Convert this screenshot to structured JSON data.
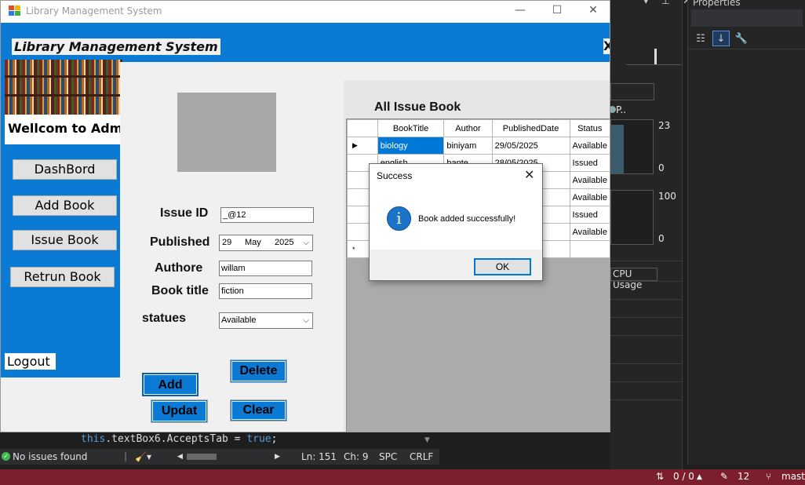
{
  "ide": {
    "properties_title": "Properties",
    "process_label": "P..",
    "diag_values": [
      "23",
      "0",
      "100",
      "0"
    ],
    "cpu_usage_label": "CPU Usage",
    "code_line": {
      "this": "this",
      "mid": ".textBox6.AcceptsTab = ",
      "true": "true",
      "end": ";"
    },
    "status": {
      "issues": "No issues found",
      "ln": "Ln: 151",
      "ch": "Ch: 9",
      "spc": "SPC",
      "crlf": "CRLF"
    },
    "vs_status": {
      "git_counts": "0 / 0",
      "changes": "12",
      "branch": "maste"
    }
  },
  "window": {
    "title": "Library Management System"
  },
  "header": {
    "app_title": "Library Management System",
    "close": "X"
  },
  "sidebar": {
    "welcome": "Wellcom to Admin",
    "buttons": [
      "DashBord",
      "Add Book",
      "Issue Book",
      "Retrun Book"
    ],
    "logout": "Logout"
  },
  "form": {
    "labels": {
      "issue_id": "Issue ID",
      "published": "Published",
      "authore": "Authore",
      "book_title": "Book title",
      "statues": "statues"
    },
    "values": {
      "issue_id": "_@12",
      "published_day": "29",
      "published_month": "May",
      "published_year": "2025",
      "authore": "willam",
      "book_title": "fiction",
      "statues": "Available"
    },
    "buttons": {
      "add": "Add",
      "delete": "Delete",
      "update": "Updat",
      "clear": "Clear"
    }
  },
  "grid": {
    "title": "All Issue Book",
    "columns": [
      "BookTitle",
      "Author",
      "PublishedDate",
      "Status"
    ],
    "rows": [
      [
        "biology",
        "biniyam",
        "29/05/2025",
        "Available"
      ],
      [
        "english",
        "bante",
        "28/05/2025",
        "Issued"
      ],
      [
        "",
        "",
        "",
        "Available"
      ],
      [
        "",
        "",
        "",
        "Available"
      ],
      [
        "",
        "",
        "",
        "Issued"
      ],
      [
        "",
        "",
        "",
        "Available"
      ]
    ],
    "new_row_marker": "*"
  },
  "dialog": {
    "title": "Success",
    "message": "Book added successfully!",
    "ok": "OK",
    "close": "✕",
    "icon": "i"
  }
}
